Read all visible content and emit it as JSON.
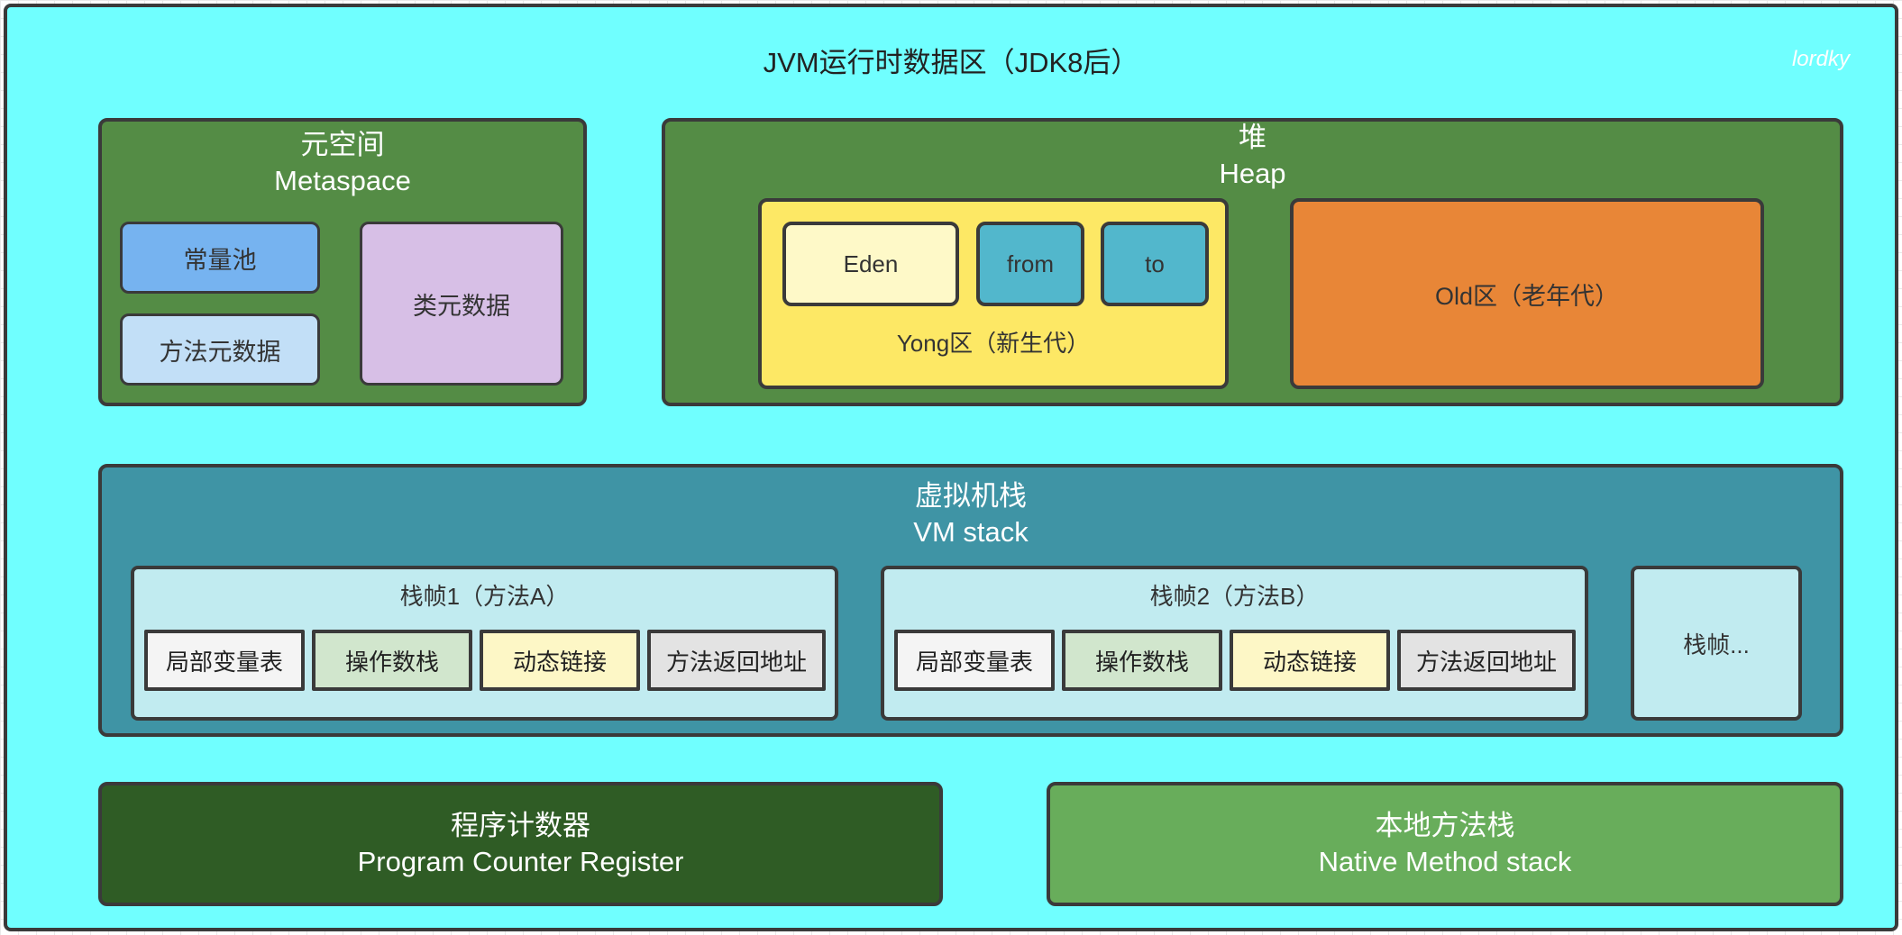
{
  "title": "JVM运行时数据区（JDK8后）",
  "watermark": "lordky",
  "metaspace": {
    "title_cn": "元空间",
    "title_en": "Metaspace",
    "constant_pool": "常量池",
    "method_metadata": "方法元数据",
    "class_metadata": "类元数据"
  },
  "heap": {
    "title_cn": "堆",
    "title_en": "Heap",
    "young": {
      "label": "Yong区（新生代）",
      "eden": "Eden",
      "from": "from",
      "to": "to"
    },
    "old": "Old区（老年代）"
  },
  "vm_stack": {
    "title_cn": "虚拟机栈",
    "title_en": "VM stack",
    "frames": [
      {
        "title": "栈帧1（方法A）",
        "cells": [
          "局部变量表",
          "操作数栈",
          "动态链接",
          "方法返回地址"
        ]
      },
      {
        "title": "栈帧2（方法B）",
        "cells": [
          "局部变量表",
          "操作数栈",
          "动态链接",
          "方法返回地址"
        ]
      }
    ],
    "more_frames": "栈帧..."
  },
  "program_counter": {
    "title_cn": "程序计数器",
    "title_en": "Program Counter Register"
  },
  "native_method_stack": {
    "title_cn": "本地方法栈",
    "title_en": "Native Method stack"
  },
  "colors": {
    "background": "#70ffff",
    "green_region": "#548c45",
    "constant_pool": "#76b3f0",
    "method_metadata": "#c2dff7",
    "class_metadata": "#d7bfe6",
    "young": "#fde865",
    "eden": "#fef9c8",
    "survivor": "#52b7cc",
    "old": "#e88637",
    "vm_stack": "#3f94a5",
    "frame": "#c1ebf0",
    "program_counter": "#2f5c25",
    "native_method_stack": "#68ad5b"
  }
}
